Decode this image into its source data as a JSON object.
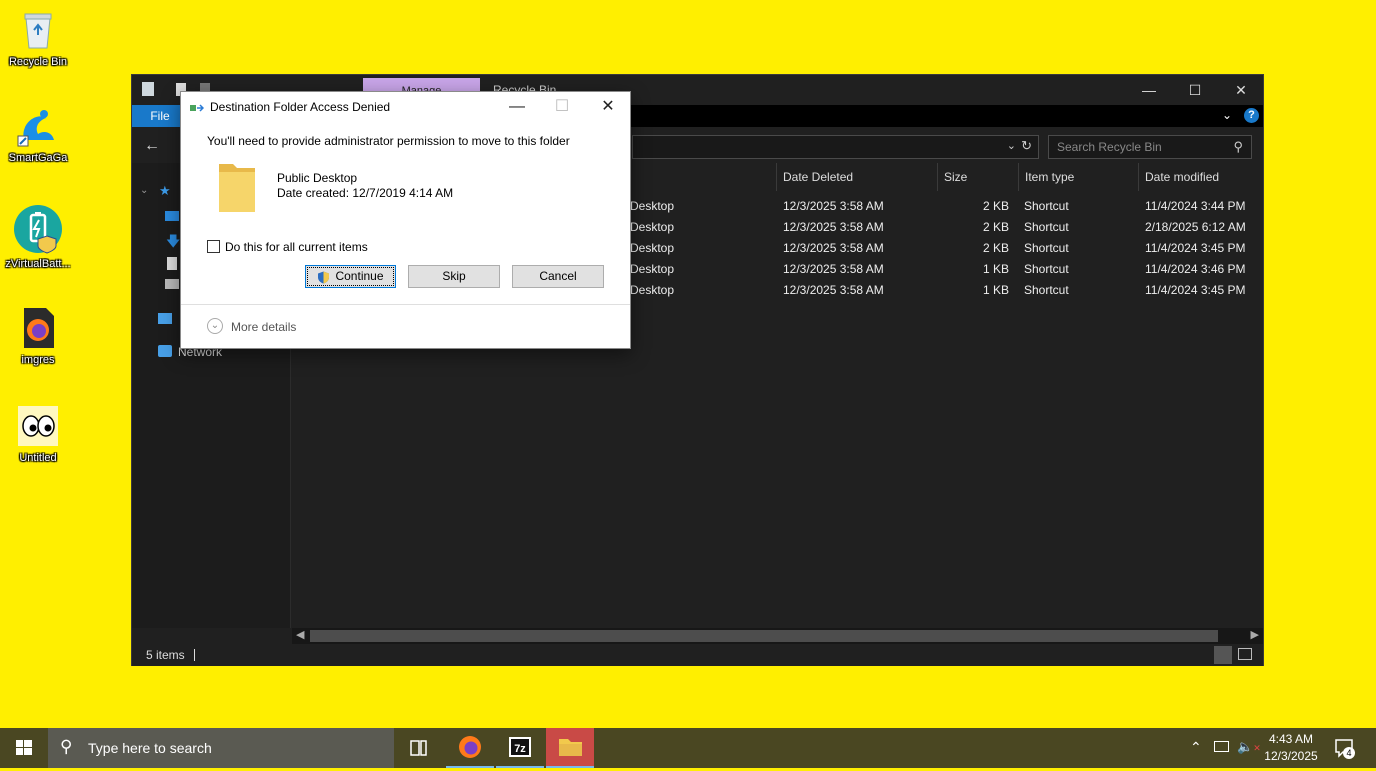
{
  "desktop": {
    "icons": [
      {
        "label": "Recycle Bin"
      },
      {
        "label": "SmartGaGa"
      },
      {
        "label": "zVirtualBatt..."
      },
      {
        "label": "imgres"
      },
      {
        "label": "Untitled"
      }
    ]
  },
  "explorer": {
    "title": "Recycle Bin",
    "manage_tab": "Manage",
    "file_tab": "File",
    "search_placeholder": "Search Recycle Bin",
    "columns": [
      "Date Deleted",
      "Size",
      "Item type",
      "Date modified"
    ],
    "rows": [
      {
        "location": "Desktop",
        "date_deleted": "12/3/2025 3:58 AM",
        "size": "2 KB",
        "type": "Shortcut",
        "modified": "11/4/2024 3:44 PM"
      },
      {
        "location": "Desktop",
        "date_deleted": "12/3/2025 3:58 AM",
        "size": "2 KB",
        "type": "Shortcut",
        "modified": "2/18/2025 6:12 AM"
      },
      {
        "location": "Desktop",
        "date_deleted": "12/3/2025 3:58 AM",
        "size": "2 KB",
        "type": "Shortcut",
        "modified": "11/4/2024 3:45 PM"
      },
      {
        "location": "Desktop",
        "date_deleted": "12/3/2025 3:58 AM",
        "size": "1 KB",
        "type": "Shortcut",
        "modified": "11/4/2024 3:46 PM"
      },
      {
        "location": "Desktop",
        "date_deleted": "12/3/2025 3:58 AM",
        "size": "1 KB",
        "type": "Shortcut",
        "modified": "11/4/2024 3:45 PM"
      }
    ],
    "nav_network": "Network",
    "status": "5 items"
  },
  "dialog": {
    "title": "Destination Folder Access Denied",
    "message": "You'll need to provide administrator permission to move to this folder",
    "folder_name": "Public Desktop",
    "folder_date": "Date created: 12/7/2019 4:14 AM",
    "checkbox_label": "Do this for all current items",
    "continue_label": "Continue",
    "skip_label": "Skip",
    "cancel_label": "Cancel",
    "more_details": "More details"
  },
  "taskbar": {
    "search_placeholder": "Type here to search",
    "time": "4:43 AM",
    "date": "12/3/2025",
    "notification_count": "4"
  },
  "colors": {
    "desktop_bg": "#FFEF00",
    "explorer_bg": "#202020",
    "accent": "#1979CA",
    "manage_tab": "#C8A5E8"
  }
}
